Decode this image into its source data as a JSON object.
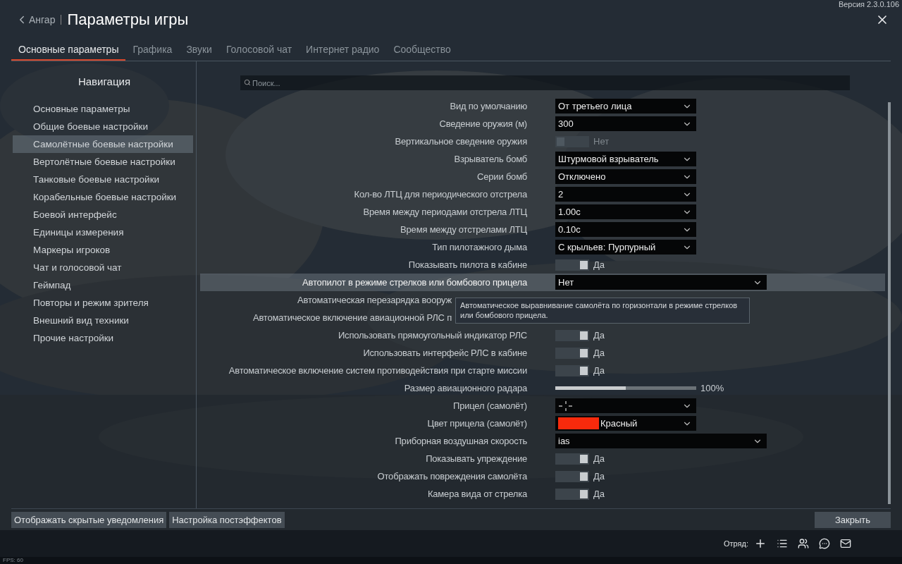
{
  "header": {
    "back": "Ангар",
    "title": "Параметры игры",
    "version": "Версия 2.3.0.106"
  },
  "tabs": [
    {
      "label": "Основные параметры",
      "selected": true
    },
    {
      "label": "Графика",
      "selected": false
    },
    {
      "label": "Звуки",
      "selected": false
    },
    {
      "label": "Голосовой чат",
      "selected": false
    },
    {
      "label": "Интернет радио",
      "selected": false
    },
    {
      "label": "Сообщество",
      "selected": false
    }
  ],
  "navigation": {
    "title": "Навигация",
    "items": [
      {
        "label": "Основные параметры",
        "selected": false
      },
      {
        "label": "Общие боевые настройки",
        "selected": false
      },
      {
        "label": "Самолётные боевые настройки",
        "selected": true
      },
      {
        "label": "Вертолётные боевые настройки",
        "selected": false
      },
      {
        "label": "Танковые боевые настройки",
        "selected": false
      },
      {
        "label": "Корабельные боевые настройки",
        "selected": false
      },
      {
        "label": "Боевой интерфейс",
        "selected": false
      },
      {
        "label": "Единицы измерения",
        "selected": false
      },
      {
        "label": "Маркеры игроков",
        "selected": false
      },
      {
        "label": "Чат и голосовой чат",
        "selected": false
      },
      {
        "label": "Геймпад",
        "selected": false
      },
      {
        "label": "Повторы и режим зрителя",
        "selected": false
      },
      {
        "label": "Внешний вид техники",
        "selected": false
      },
      {
        "label": "Прочие настройки",
        "selected": false
      }
    ]
  },
  "search": {
    "placeholder": "Поиск..."
  },
  "settings": [
    {
      "label": "Вид по умолчанию",
      "kind": "select",
      "value": "От третьего лица",
      "selected": false
    },
    {
      "label": "Сведение оружия (м)",
      "kind": "select",
      "value": "300",
      "selected": false
    },
    {
      "label": "Вертикальное сведение оружия",
      "kind": "toggle",
      "on": false,
      "reading": "Нет",
      "selected": false
    },
    {
      "label": "Взрыватель бомб",
      "kind": "select",
      "value": "Штурмовой взрыватель",
      "selected": false
    },
    {
      "label": "Серии бомб",
      "kind": "select",
      "value": "Отключено",
      "selected": false
    },
    {
      "label": "Кол-во ЛТЦ для периодического отстрела",
      "kind": "select",
      "value": "2",
      "selected": false
    },
    {
      "label": "Время между периодами отстрела ЛТЦ",
      "kind": "select",
      "value": "1.00с",
      "selected": false
    },
    {
      "label": "Время между отстрелами ЛТЦ",
      "kind": "select",
      "value": "0.10с",
      "selected": false
    },
    {
      "label": "Тип пилотажного дыма",
      "kind": "select",
      "value": "С крыльев: Пурпурный",
      "selected": false
    },
    {
      "label": "Показывать пилота в кабине",
      "kind": "toggle",
      "on": true,
      "reading": "Да",
      "selected": false
    },
    {
      "label": "Автопилот в режиме стрелков или бомбового прицела",
      "kind": "wideselect",
      "value": "Нет",
      "selected": true
    },
    {
      "label": "Автоматическая перезарядка вооруж",
      "kind": "covered",
      "selected": false
    },
    {
      "label": "Автоматическое включение авиационной РЛС п",
      "kind": "covered",
      "selected": false
    },
    {
      "label": "Использовать прямоугольный индикатор РЛС",
      "kind": "toggle",
      "on": true,
      "reading": "Да",
      "selected": false
    },
    {
      "label": "Использовать интерфейс РЛС в кабине",
      "kind": "toggle",
      "on": true,
      "reading": "Да",
      "selected": false
    },
    {
      "label": "Автоматическое включение систем противодействия при старте миссии",
      "kind": "toggle",
      "on": true,
      "reading": "Да",
      "selected": false
    },
    {
      "label": "Размер авиационного радара",
      "kind": "slider",
      "level": 0.5,
      "reading": "100%",
      "selected": false
    },
    {
      "label": "Прицел (самолёт)",
      "kind": "reticle",
      "selected": false
    },
    {
      "label": "Цвет прицела (самолёт)",
      "kind": "select",
      "color": "#f82a0c",
      "value": "Красный",
      "selected": false
    },
    {
      "label": "Приборная воздушная скорость",
      "kind": "wideselect",
      "value": "ias",
      "selected": false
    },
    {
      "label": "Показывать упреждение",
      "kind": "toggle",
      "on": true,
      "reading": "Да",
      "selected": false
    },
    {
      "label": "Отображать повреждения самолёта",
      "kind": "toggle",
      "on": true,
      "reading": "Да",
      "selected": false
    },
    {
      "label": "Камера вида от стрелка",
      "kind": "toggle",
      "on": true,
      "reading": "Да",
      "selected": false
    }
  ],
  "tooltip": "Автоматическое выравнивание самолёта по горизонтали в режиме стрелков или бомбового прицела.",
  "footer_buttons": [
    "Отображать скрытые уведомления",
    "Настройка постэффектов"
  ],
  "close_button": "Закрыть",
  "squad_label": "Отряд:",
  "fps": "FPS: 60"
}
